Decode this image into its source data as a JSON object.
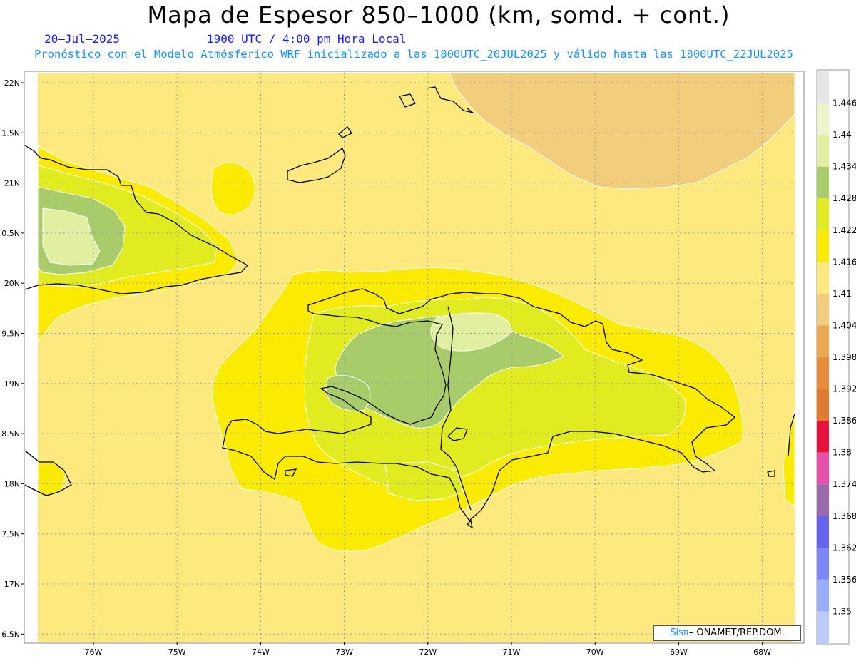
{
  "title": "Mapa de Espesor 850–1000 (km, somd. + cont.)",
  "subtitle": {
    "date": "20–Jul–2025",
    "time": "1900 UTC / 4:00 pm Hora Local",
    "model": "Pronóstico con el Modelo Atmósferico WRF inicializado a las 1800UTC_20JUL2025 y válido hasta las  1800UTC_22JUL2025"
  },
  "axes": {
    "lon_labels": [
      "76W",
      "75W",
      "74W",
      "73W",
      "72W",
      "71W",
      "70W",
      "69W",
      "68W"
    ],
    "lat_labels": [
      "22N",
      "1.5N",
      "21N",
      "0.5N",
      "20N",
      "9.5N",
      "19N",
      "8.5N",
      "18N",
      "7.5N",
      "17N",
      "6.5N"
    ]
  },
  "colorbar": {
    "labels": [
      "1.446",
      "1.44",
      "1.434",
      "1.428",
      "1.422",
      "1.416",
      "1.41",
      "1.404",
      "1.398",
      "1.392",
      "1.386",
      "1.38",
      "1.374",
      "1.368",
      "1.362",
      "1.356",
      "1.35"
    ],
    "colors": [
      "#e6e6e6",
      "#eef3cc",
      "#e0f0a0",
      "#a8cc6a",
      "#e0ec20",
      "#fbeb00",
      "#fde97e",
      "#f2cd7c",
      "#eca850",
      "#e88c3a",
      "#e07a30",
      "#e8103c",
      "#e650a8",
      "#9a6aaa",
      "#6464f0",
      "#7c86f8",
      "#98aefc",
      "#bccafe"
    ]
  },
  "fill_colors": {
    "sea": "#fde97e",
    "dry_patch": "#f2cd7c",
    "yellow": "#fbeb00",
    "lime": "#e0ec20",
    "green": "#a8cc6a",
    "pale": "#e0f0a0",
    "coast": "#000000",
    "grid": "#9a9aa8"
  },
  "credit": {
    "brand": "Sis",
    "pi": "π",
    "text": "– ONAMET/REP.DOM."
  }
}
